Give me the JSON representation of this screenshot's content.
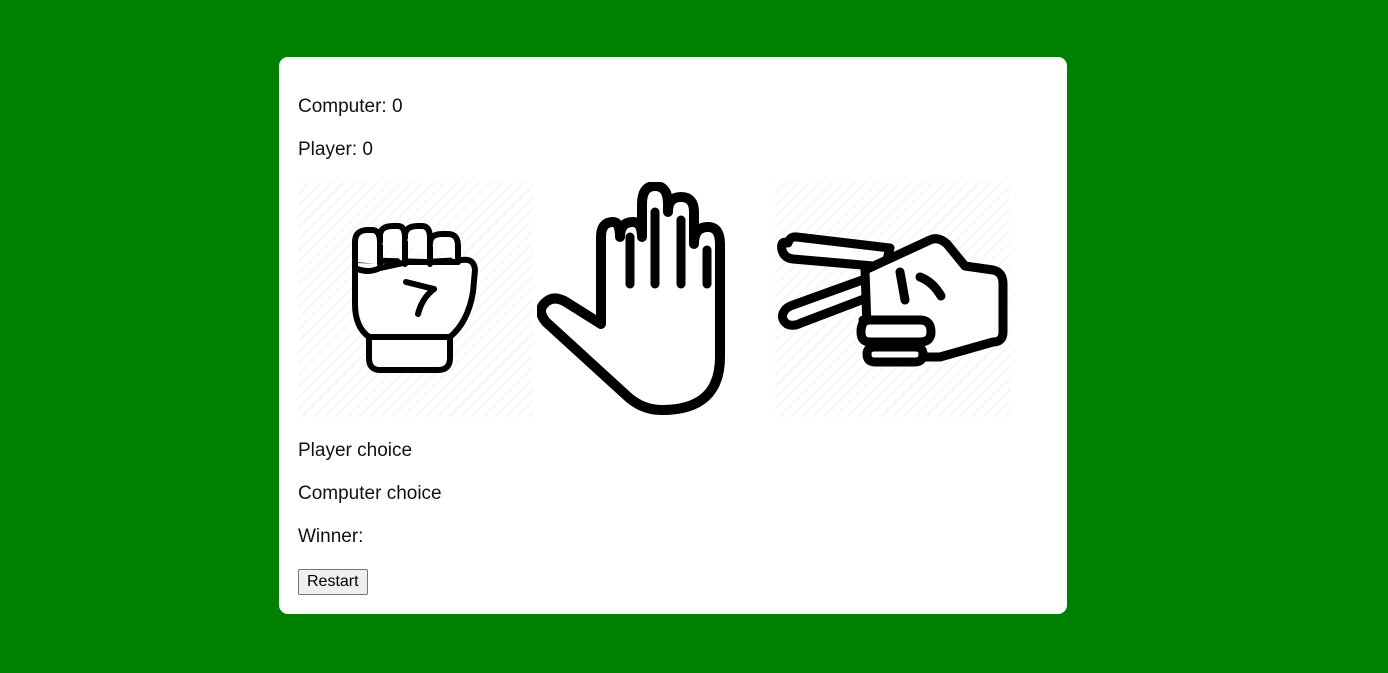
{
  "scores": {
    "computer_text": "Computer: 0",
    "player_text": "Player: 0"
  },
  "choices": [
    {
      "name": "rock",
      "icon": "fist-icon"
    },
    {
      "name": "paper",
      "icon": "open-hand-icon"
    },
    {
      "name": "scissors",
      "icon": "peace-sign-hand-icon"
    }
  ],
  "result": {
    "player_choice_text": "Player choice",
    "computer_choice_text": "Computer choice",
    "winner_text": "Winner:"
  },
  "controls": {
    "restart_label": "Restart"
  },
  "colors": {
    "background": "#008000",
    "card": "#ffffff",
    "icon_stroke": "#000000"
  }
}
